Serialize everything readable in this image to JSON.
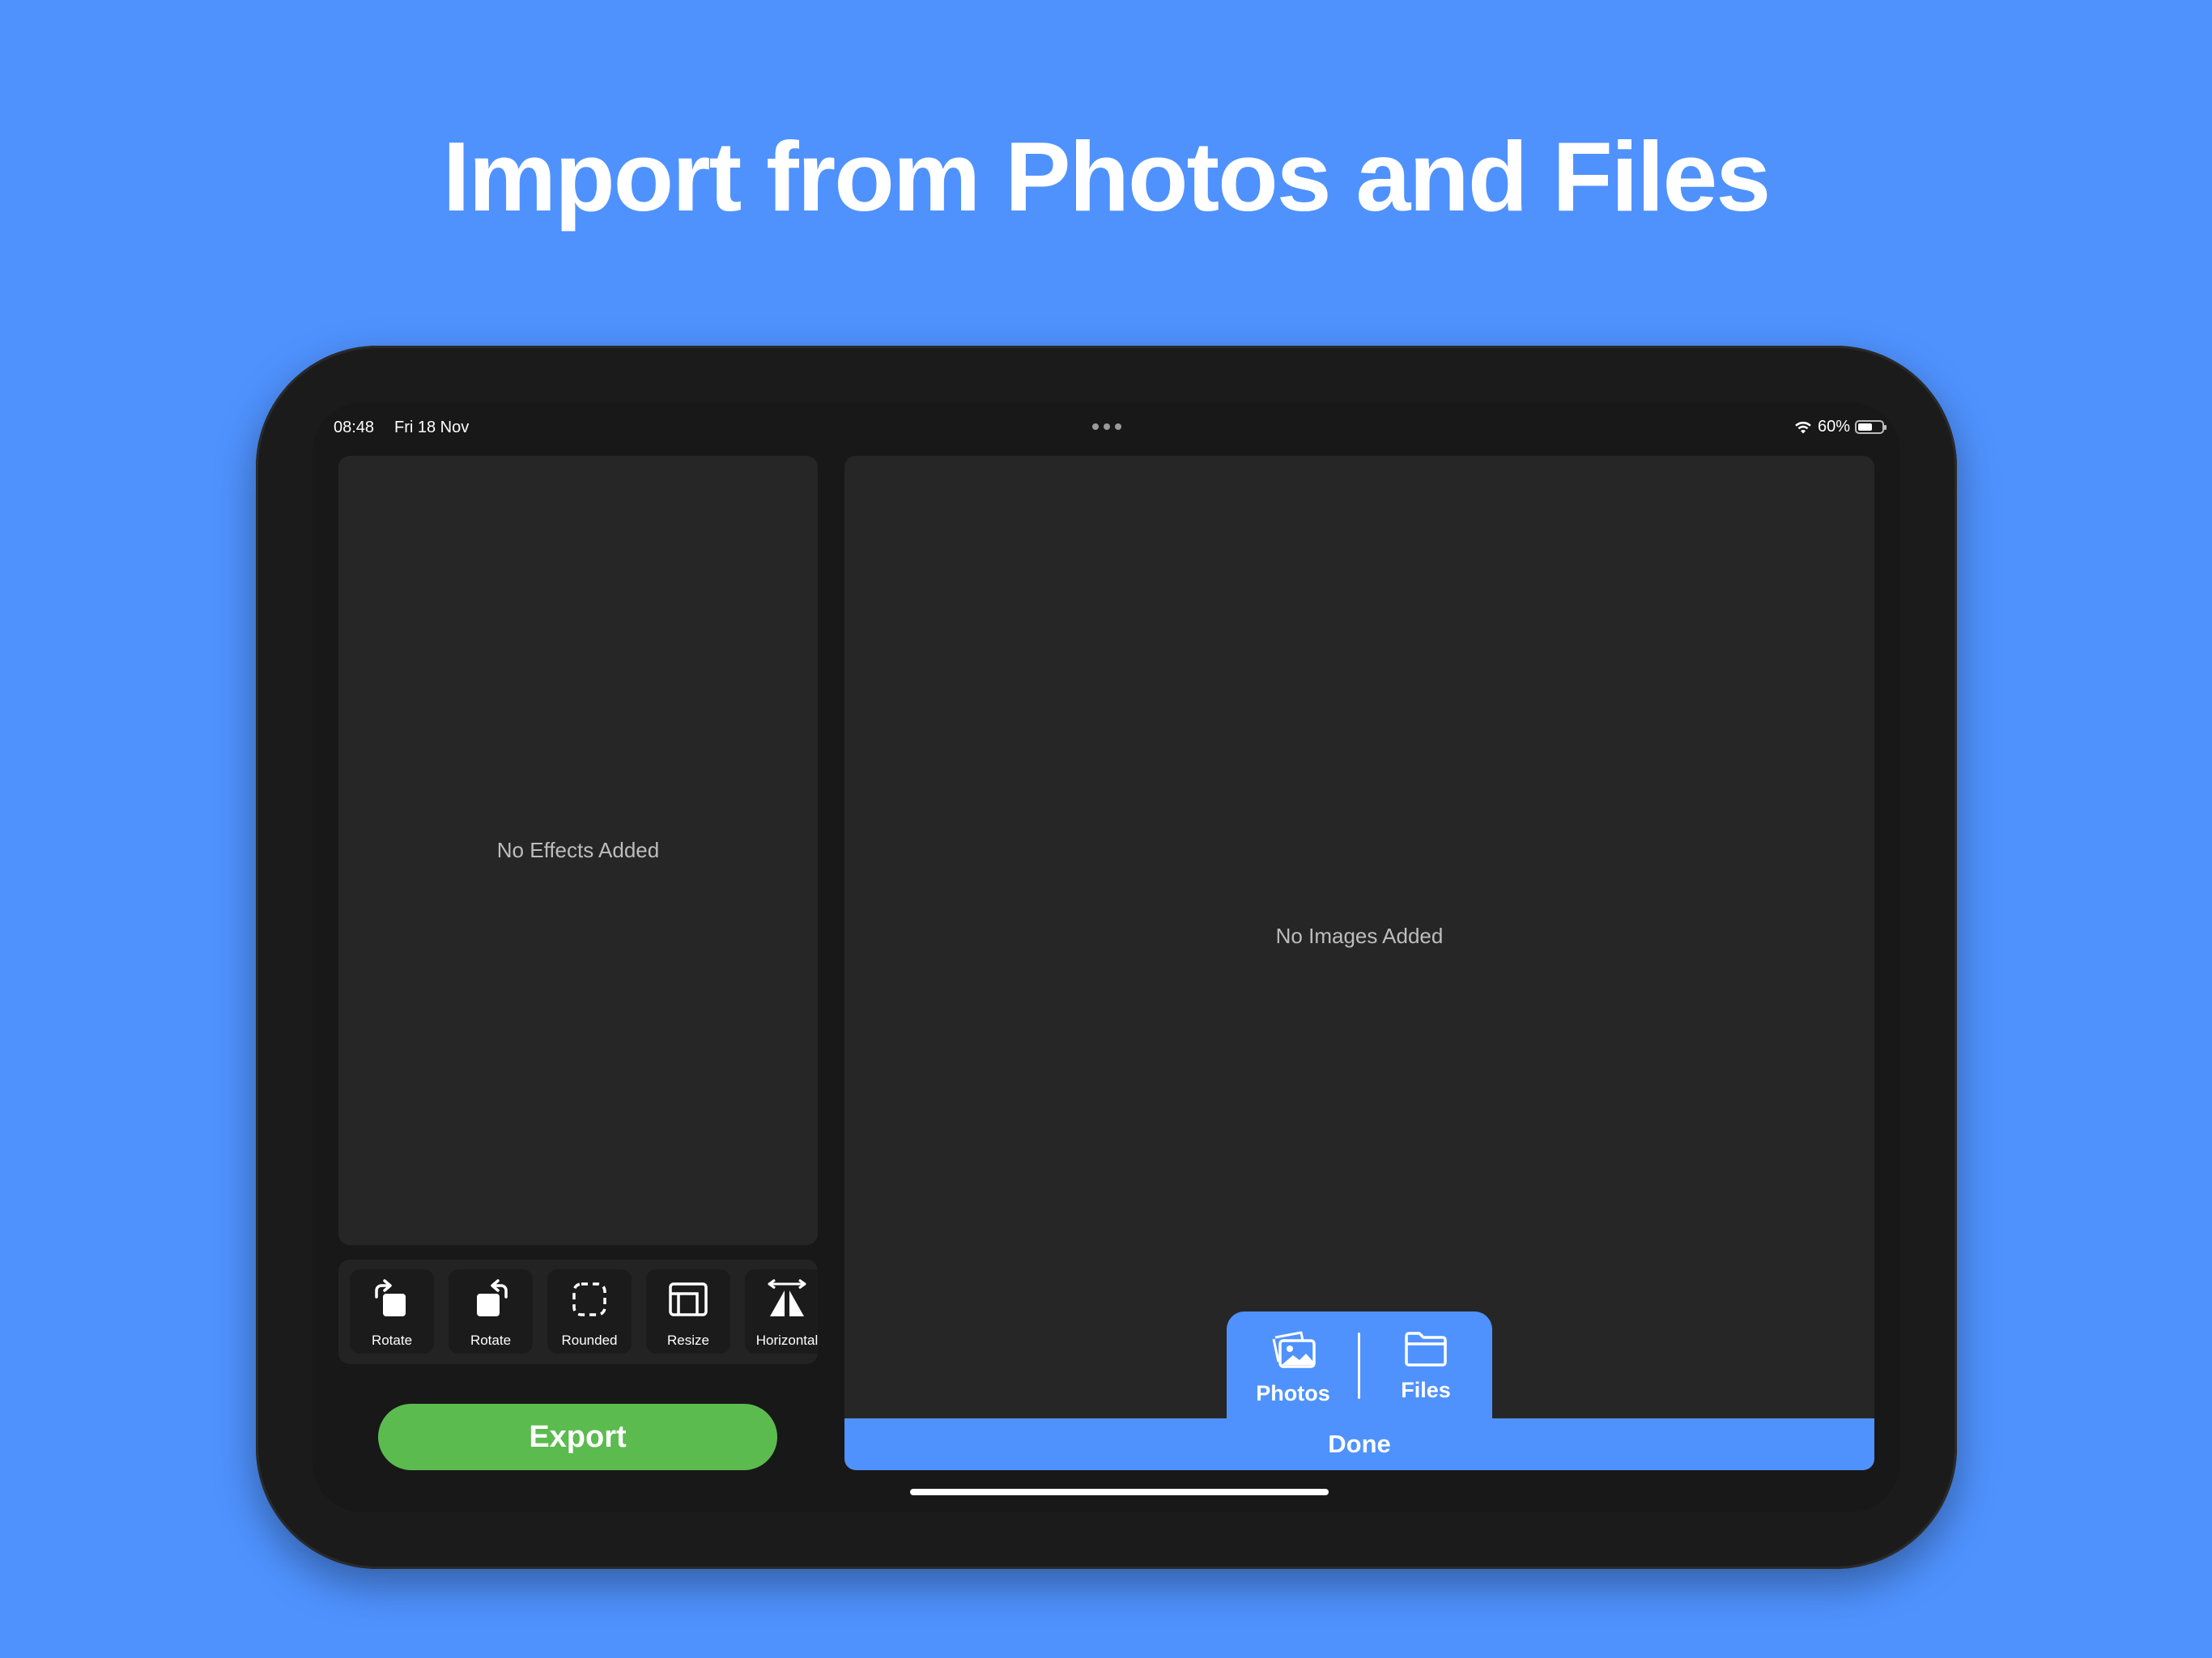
{
  "headline": "Import from Photos and Files",
  "status_bar": {
    "time": "08:48",
    "date": "Fri 18 Nov",
    "battery": "60%",
    "battery_level": 0.6
  },
  "effects_panel": {
    "empty_text": "No Effects Added"
  },
  "toolbar": {
    "tools": [
      {
        "label": "Rotate",
        "icon": "rotate-right-icon"
      },
      {
        "label": "Rotate",
        "icon": "rotate-left-icon"
      },
      {
        "label": "Rounded",
        "icon": "rounded-corners-icon"
      },
      {
        "label": "Resize",
        "icon": "resize-icon"
      },
      {
        "label": "Horizontal",
        "icon": "flip-horizontal-icon"
      }
    ]
  },
  "export_label": "Export",
  "images_panel": {
    "empty_text": "No Images Added"
  },
  "import_menu": {
    "photos_label": "Photos",
    "files_label": "Files",
    "done_label": "Done"
  },
  "colors": {
    "background": "#4f92fe",
    "accent": "#4f92fe",
    "export": "#5bbb4f",
    "panel": "#262626",
    "device": "#1b1b1b"
  }
}
